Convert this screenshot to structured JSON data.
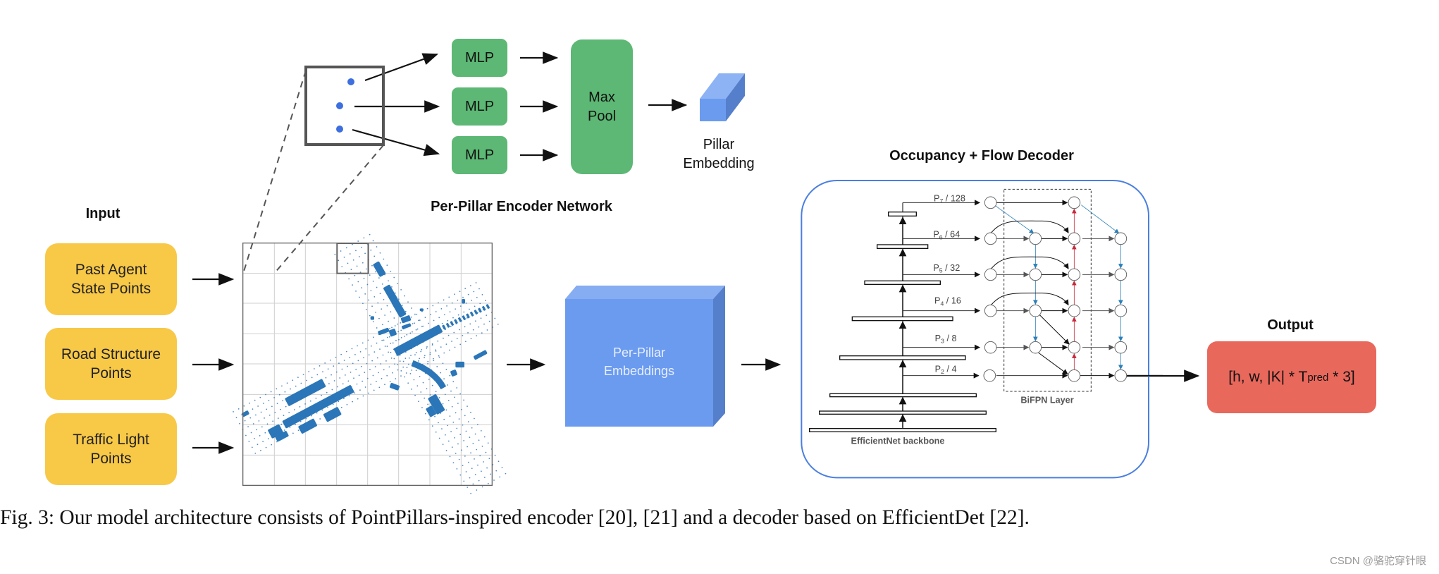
{
  "input": {
    "title": "Input",
    "items": [
      "Past Agent\nState Points",
      "Road Structure\nPoints",
      "Traffic Light\nPoints"
    ]
  },
  "encoder": {
    "title": "Per-Pillar Encoder Network",
    "mlp_label": "MLP",
    "maxpool_label": "Max\nPool",
    "pillar_embedding_label": "Pillar\nEmbedding"
  },
  "embeddings": {
    "label": "Per-Pillar\nEmbeddings"
  },
  "decoder": {
    "title": "Occupancy + Flow Decoder",
    "backbone_label": "EfficientNet backbone",
    "bifpn_label": "BiFPN Layer",
    "levels": [
      {
        "base": "P",
        "sub": "7",
        "rest": " / 128"
      },
      {
        "base": "P",
        "sub": "6",
        "rest": " / 64"
      },
      {
        "base": "P",
        "sub": "5",
        "rest": " / 32"
      },
      {
        "base": "P",
        "sub": "4",
        "rest": " / 16"
      },
      {
        "base": "P",
        "sub": "3",
        "rest": " / 8"
      },
      {
        "base": "P",
        "sub": "2",
        "rest": " / 4"
      }
    ]
  },
  "output": {
    "title": "Output",
    "pre": "[h, w, |K| * T",
    "sub": "pred",
    "post": " * 3]"
  },
  "caption": "Fig. 3: Our model architecture consists of PointPillars-inspired encoder [20], [21] and a decoder based on EfficientDet [22].",
  "watermark": "CSDN @骆驼穿针眼",
  "colors": {
    "input_box": "#f8c847",
    "mlp": "#5cb874",
    "embedding": "#6b9bef",
    "decoder_border": "#4a7fe0",
    "output_box": "#e8685c",
    "agent": "#2a76b8",
    "top_down_arrow": "#2a7fb8",
    "bottom_up_arrow": "#c8283a"
  }
}
